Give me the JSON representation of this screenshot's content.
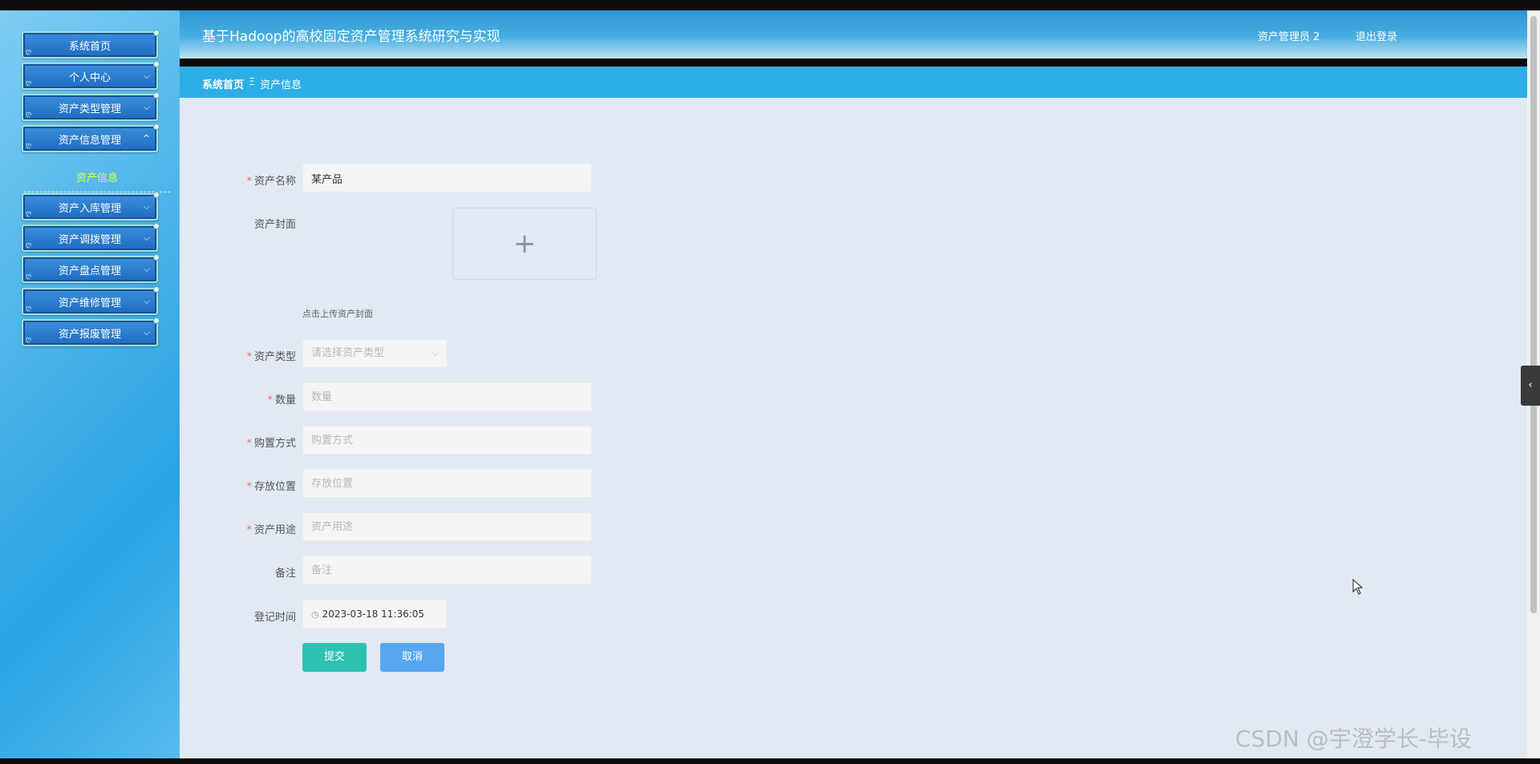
{
  "header": {
    "title": "基于Hadoop的高校固定资产管理系统研究与实现",
    "user": "资产管理员 2",
    "logout": "退出登录"
  },
  "sidebar": {
    "items": [
      {
        "label": "系统首页"
      },
      {
        "label": "个人中心"
      },
      {
        "label": "资产类型管理"
      },
      {
        "label": "资产信息管理"
      },
      {
        "label": "资产入库管理"
      },
      {
        "label": "资产调拨管理"
      },
      {
        "label": "资产盘点管理"
      },
      {
        "label": "资产维修管理"
      },
      {
        "label": "资产报废管理"
      }
    ],
    "sub_item": "资产信息"
  },
  "breadcrumb": {
    "home": "系统首页",
    "separator": "Ξ",
    "current": "资产信息"
  },
  "form": {
    "name": {
      "label": "资产名称",
      "value": "某产品"
    },
    "cover": {
      "label": "资产封面",
      "tip": "点击上传资产封面",
      "plus": "+"
    },
    "type": {
      "label": "资产类型",
      "placeholder": "请选择资产类型",
      "arrow": "⌵"
    },
    "quantity": {
      "label": "数量",
      "placeholder": "数量"
    },
    "purchase": {
      "label": "购置方式",
      "placeholder": "购置方式"
    },
    "location": {
      "label": "存放位置",
      "placeholder": "存放位置"
    },
    "usage": {
      "label": "资产用途",
      "placeholder": "资产用途"
    },
    "remark": {
      "label": "备注",
      "placeholder": "备注"
    },
    "time": {
      "label": "登记时间",
      "value": "2023-03-18 11:36:05"
    },
    "required_mark": "*"
  },
  "buttons": {
    "submit": "提交",
    "cancel": "取消"
  },
  "collapse_tab": "‹",
  "watermark": "CSDN @宇澄学长-毕设",
  "colors": {
    "accent": "#2daee6",
    "submit": "#2ec1b3",
    "cancel": "#56a6f0",
    "sub_item": "#e0ff3f"
  }
}
